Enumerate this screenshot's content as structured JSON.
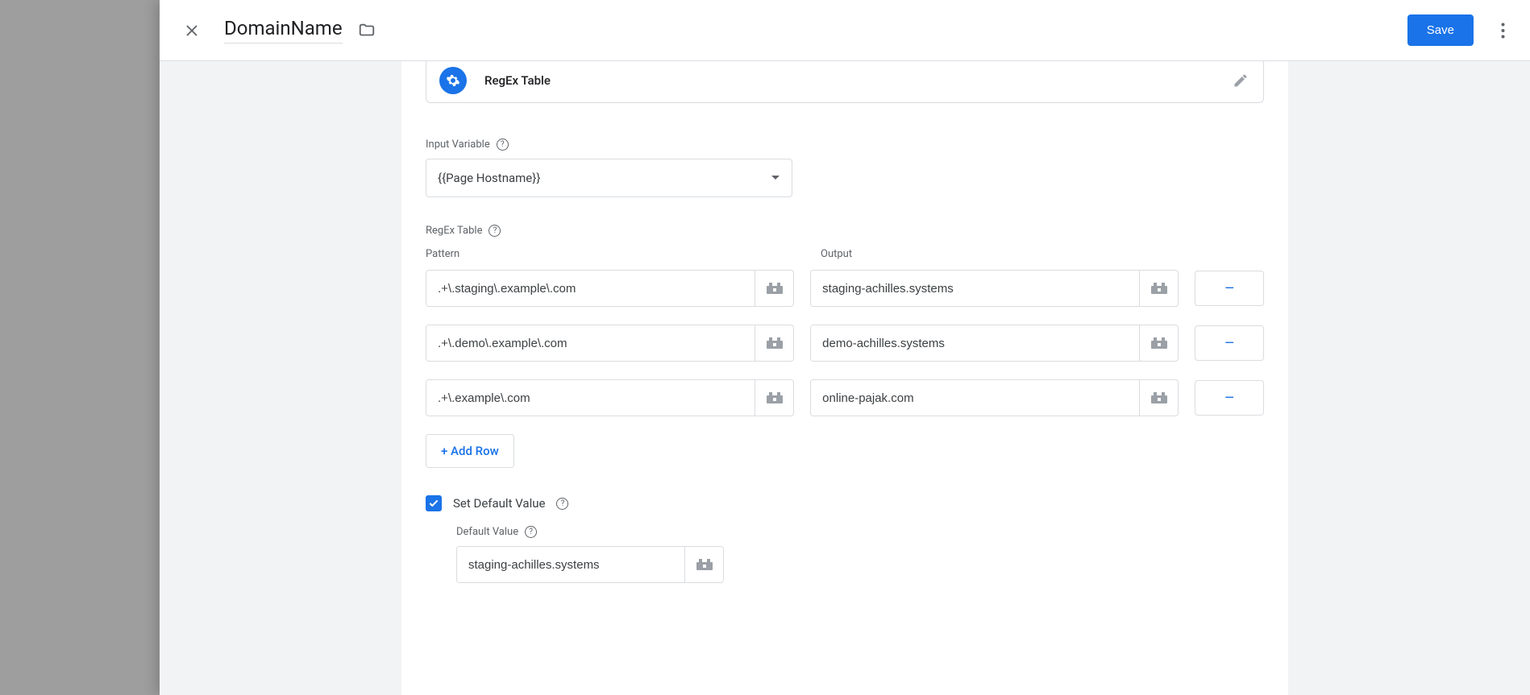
{
  "header": {
    "title": "DomainName",
    "save_label": "Save"
  },
  "variable_type": {
    "label": "RegEx Table"
  },
  "input_variable": {
    "section_label": "Input Variable",
    "selected": "{{Page Hostname}}"
  },
  "regex_table": {
    "section_label": "RegEx Table",
    "pattern_header": "Pattern",
    "output_header": "Output",
    "rows": [
      {
        "pattern": ".+\\.staging\\.example\\.com",
        "output": "staging-achilles.systems"
      },
      {
        "pattern": ".+\\.demo\\.example\\.com",
        "output": "demo-achilles.systems"
      },
      {
        "pattern": ".+\\.example\\.com",
        "output": "online-pajak.com"
      }
    ],
    "add_row_label": "+ Add Row",
    "remove_label": "−"
  },
  "default_value": {
    "checkbox_label": "Set Default Value",
    "checked": true,
    "field_label": "Default Value",
    "value": "staging-achilles.systems"
  }
}
